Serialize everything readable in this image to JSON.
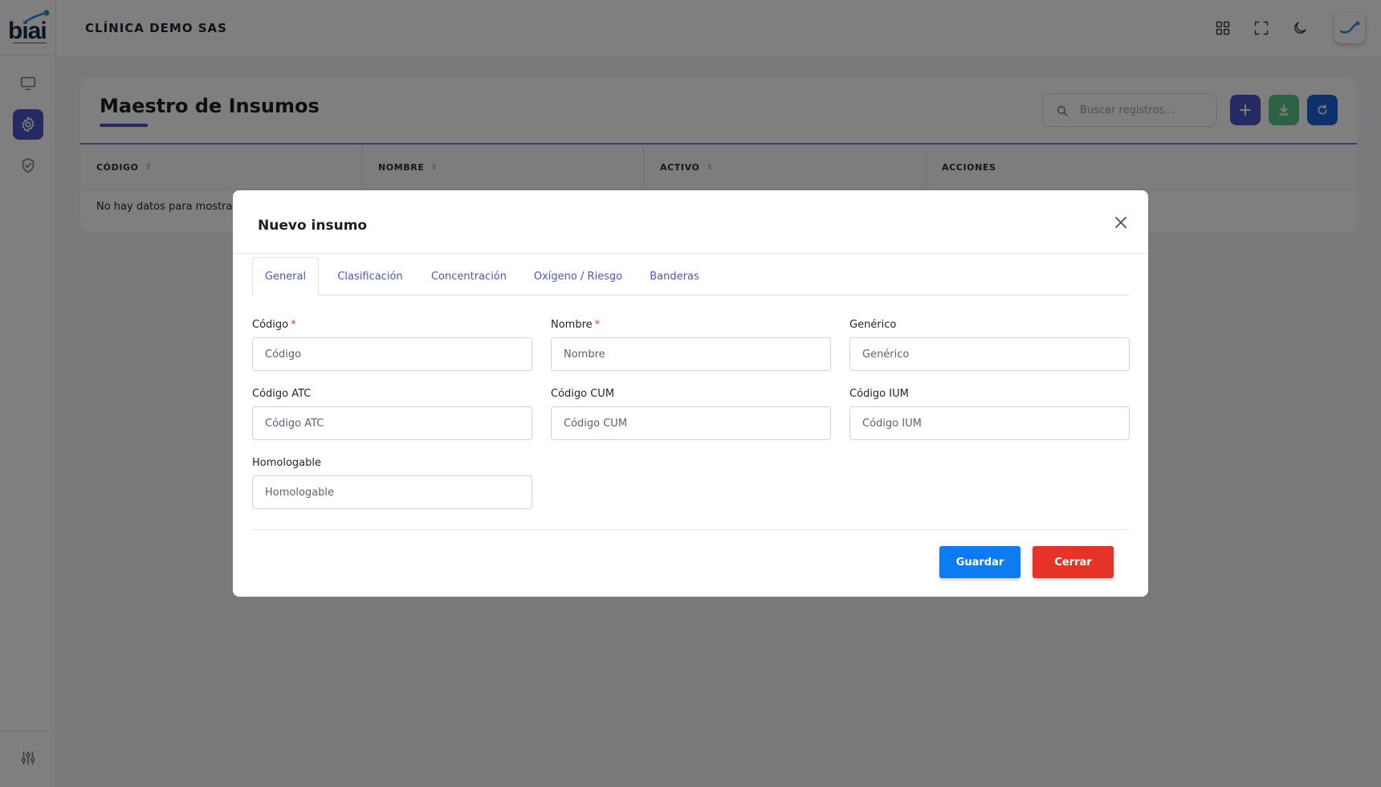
{
  "app": {
    "logo_text": "biai",
    "clinic_name": "CLÍNICA DEMO SAS"
  },
  "sidebar": {
    "items": [
      {
        "icon": "monitor-icon",
        "active": false
      },
      {
        "icon": "gear-icon",
        "active": true
      },
      {
        "icon": "shield-check-icon",
        "active": false
      }
    ],
    "bottom_icon": "sliders-icon"
  },
  "topbar": {
    "icons": [
      "grid-icon",
      "fullscreen-icon",
      "moon-icon"
    ],
    "avatar_icon": "brand-avatar-icon"
  },
  "page": {
    "title": "Maestro de Insumos",
    "search_placeholder": "Buscar registros...",
    "actions": [
      {
        "name": "add-button",
        "icon": "plus-icon",
        "color": "#4b55c4"
      },
      {
        "name": "download-button",
        "icon": "download-icon",
        "color": "#5cc48a"
      },
      {
        "name": "refresh-button",
        "icon": "refresh-icon",
        "color": "#1d63d8"
      }
    ],
    "table": {
      "columns": [
        "CÓDIGO",
        "NOMBRE",
        "ACTIVO",
        "ACCIONES"
      ],
      "empty_text": "No hay datos para mostrar"
    }
  },
  "modal": {
    "title": "Nuevo insumo",
    "tabs": [
      "General",
      "Clasificación",
      "Concentración",
      "Oxígeno / Riesgo",
      "Banderas"
    ],
    "active_tab": "General",
    "fields": [
      {
        "label": "Código",
        "placeholder": "Código",
        "value": "",
        "required": true
      },
      {
        "label": "Nombre",
        "placeholder": "Nombre",
        "value": "",
        "required": true
      },
      {
        "label": "Genérico",
        "placeholder": "Genérico",
        "value": "",
        "required": false
      },
      {
        "label": "Código ATC",
        "placeholder": "Código ATC",
        "value": "",
        "required": false
      },
      {
        "label": "Código CUM",
        "placeholder": "Código CUM",
        "value": "",
        "required": false
      },
      {
        "label": "Código IUM",
        "placeholder": "Código IUM",
        "value": "",
        "required": false
      },
      {
        "label": "Homologable",
        "placeholder": "Homologable",
        "value": "",
        "required": false
      }
    ],
    "required_mark": "*",
    "save_label": "Guardar",
    "close_label": "Cerrar"
  },
  "colors": {
    "accent": "#4b55c4",
    "save": "#0d7cf2",
    "close": "#e53327",
    "overlay": "rgba(0,0,0,0.5)"
  }
}
